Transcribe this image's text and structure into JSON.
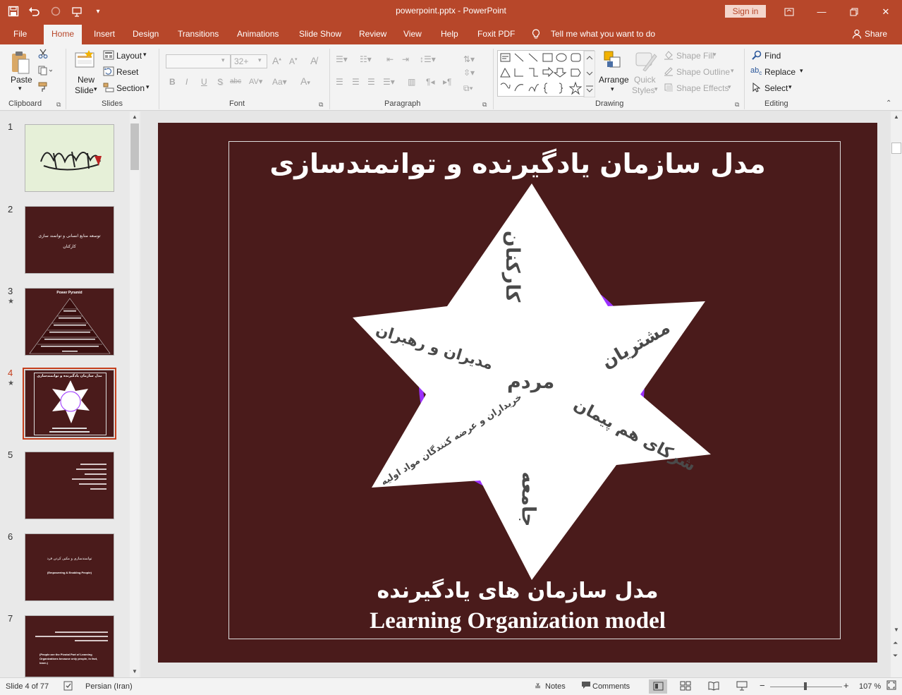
{
  "app": {
    "document_title": "powerpoint.pptx  -  PowerPoint",
    "sign_in": "Sign in",
    "share": "Share",
    "tell_me": "Tell me what you want to do",
    "accent_color": "#b7472a"
  },
  "tabs": [
    "File",
    "Home",
    "Insert",
    "Design",
    "Transitions",
    "Animations",
    "Slide Show",
    "Review",
    "View",
    "Help",
    "Foxit PDF"
  ],
  "active_tab": "Home",
  "ribbon": {
    "clipboard": {
      "label": "Clipboard",
      "paste": "Paste"
    },
    "slides": {
      "label": "Slides",
      "new_slide_1": "New",
      "new_slide_2": "Slide",
      "layout": "Layout",
      "reset": "Reset",
      "section": "Section"
    },
    "font": {
      "label": "Font",
      "font_size": "32+"
    },
    "paragraph": {
      "label": "Paragraph"
    },
    "drawing": {
      "label": "Drawing",
      "arrange": "Arrange",
      "quick_styles_1": "Quick",
      "quick_styles_2": "Styles",
      "shape_fill": "Shape Fill",
      "shape_outline": "Shape Outline",
      "shape_effects": "Shape Effects"
    },
    "editing": {
      "label": "Editing",
      "find": "Find",
      "replace": "Replace",
      "select": "Select"
    }
  },
  "slides_panel": {
    "numbers": [
      "1",
      "2",
      "3",
      "4",
      "5",
      "6",
      "7"
    ],
    "selected_index": 3,
    "thumb2_title": "توسعه منابع انسانی و توانمند سازی",
    "thumb2_sub": "کارکنان",
    "thumb3_title": "Power Pyramid",
    "thumb4_title": "مدل سازمان یادگیرنده و توانمندسازی",
    "thumb6_title": "توانمندسازی و مکین کردن فرد",
    "thumb6_sub": "(Empowering & Enabling People)",
    "thumb7_en": "(People are the Pivotal Part of Learning Organizations because only people, in fact, learn.)"
  },
  "slide": {
    "title": "مدل سازمان یادگیرنده  و توانمندسازی",
    "caption_fa": "مدل سازمان های یادگیرنده",
    "caption_en": "Learning Organization model",
    "center": "مردم",
    "points": {
      "top": "کارکنان",
      "upper_right": "مشتریان",
      "lower_right": "شرکای هم پیمان",
      "bottom": "جامعه",
      "lower_left": "خریداران و عرضه کنندگان مواد اولیه",
      "upper_left": "مدیران و رهبران"
    },
    "background_color": "#4a1b1b",
    "ring_color": "#9b30ff"
  },
  "status_bar": {
    "slide_info": "Slide 4 of 77",
    "language": "Persian (Iran)",
    "notes": "Notes",
    "comments": "Comments",
    "zoom": "107 %"
  }
}
